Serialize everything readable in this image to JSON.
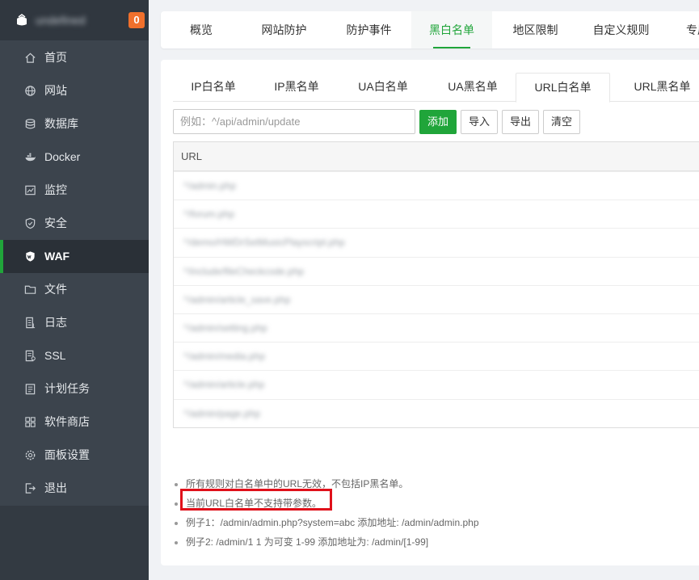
{
  "brand": {
    "name": "undefined",
    "notice_count": "0"
  },
  "sidebar": {
    "items": [
      {
        "label": "首页",
        "icon": "home-icon"
      },
      {
        "label": "网站",
        "icon": "globe-icon"
      },
      {
        "label": "数据库",
        "icon": "database-icon"
      },
      {
        "label": "Docker",
        "icon": "docker-icon"
      },
      {
        "label": "监控",
        "icon": "monitor-chart-icon"
      },
      {
        "label": "安全",
        "icon": "shield-check-icon"
      },
      {
        "label": "WAF",
        "icon": "waf-shield-icon",
        "active": true
      },
      {
        "label": "文件",
        "icon": "folder-icon"
      },
      {
        "label": "日志",
        "icon": "log-icon"
      },
      {
        "label": "SSL",
        "icon": "ssl-certificate-icon"
      },
      {
        "label": "计划任务",
        "icon": "task-list-icon"
      },
      {
        "label": "软件商店",
        "icon": "grid-apps-icon"
      },
      {
        "label": "面板设置",
        "icon": "gear-icon"
      },
      {
        "label": "退出",
        "icon": "logout-icon"
      }
    ]
  },
  "top_tabs": [
    "概览",
    "网站防护",
    "防护事件",
    "黑白名单",
    "地区限制",
    "自定义规则",
    "专属规则"
  ],
  "top_tabs_active": 3,
  "sub_tabs": [
    "IP白名单",
    "IP黑名单",
    "UA白名单",
    "UA黑名单",
    "URL白名单",
    "URL黑名单"
  ],
  "sub_tabs_active": 4,
  "toolbar": {
    "input_placeholder": "例如：^/api/admin/update",
    "add_label": "添加",
    "import_label": "导入",
    "export_label": "导出",
    "clear_label": "清空"
  },
  "table": {
    "header": "URL",
    "rows": [
      "^/admin.php",
      "^/forum.php",
      "^/demo/HWDrSetMusicPlayscript.php",
      "^/include/fileCheckcode.php",
      "^/admin/article_save.php",
      "^/admin/setting.php",
      "^/admin/media.php",
      "^/admin/article.php",
      "^/admin/page.php"
    ]
  },
  "help": [
    "所有规则对白名单中的URL无效，不包括IP黑名单。",
    "当前URL白名单不支持带参数。",
    "例子1：/admin/admin.php?system=abc 添加地址: /admin/admin.php",
    "例子2: /admin/1 1 为可变 1-99 添加地址为: /admin/[1-99]"
  ],
  "colors": {
    "accent": "#20a53a",
    "sidebar_bg": "#3c444d",
    "highlight": "#e0111b",
    "badge": "#f0702c"
  }
}
